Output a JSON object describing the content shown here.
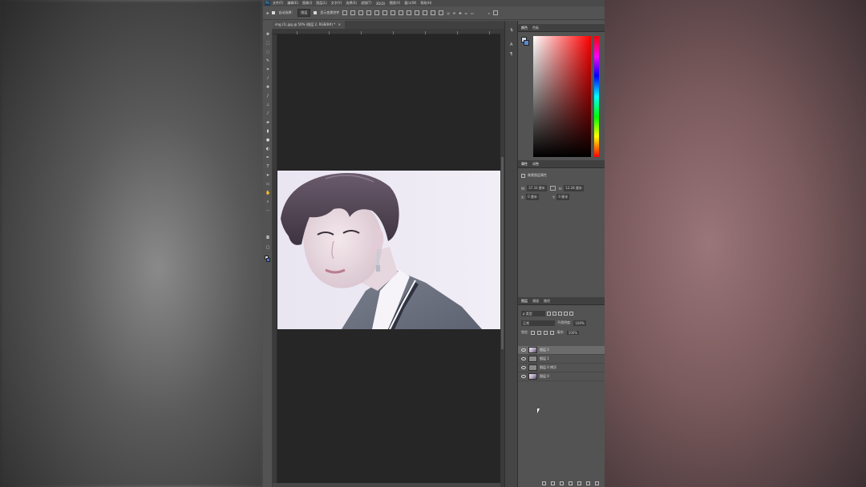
{
  "app": {
    "logo": "Ps",
    "menu": [
      "文件(F)",
      "编辑(E)",
      "图像(I)",
      "图层(L)",
      "文字(Y)",
      "选择(S)",
      "滤镜(T)",
      "3D(D)",
      "视图(V)",
      "窗口(W)",
      "帮助(H)"
    ]
  },
  "options_bar": {
    "auto_select_label": "自动选择：",
    "auto_select_value": "图层",
    "transform_label": "显示变换控件"
  },
  "document": {
    "tab_title": "img (1).jpg @ 50% (图层 2, RGB/8#) *",
    "close_glyph": "×"
  },
  "color_panel": {
    "tabs": [
      "颜色",
      "色板"
    ],
    "fg_color": "#ccd6e8",
    "bg_color": "#5a8ad0"
  },
  "properties_panel": {
    "tabs": [
      "属性",
      "调整"
    ],
    "title": "像素图层属性",
    "w_label": "W:",
    "w_value": "37.33 厘米",
    "h_label": "H:",
    "h_value": "12.28 厘米",
    "x_label": "X:",
    "x_value": "0 厘米",
    "y_label": "Y:",
    "y_value": "0 厘米",
    "link_glyph": "GO"
  },
  "layers_panel": {
    "tabs": [
      "图层",
      "通道",
      "路径"
    ],
    "filter_label": "ρ 类型",
    "blend_mode": "正常",
    "opacity_label": "不透明度:",
    "opacity_value": "100%",
    "lock_label": "锁定:",
    "fill_label": "填充:",
    "fill_value": "100%",
    "layers": [
      {
        "name": "图层 2",
        "selected": true,
        "thumb": "photo"
      },
      {
        "name": "图层 1",
        "selected": false,
        "thumb": "gray"
      },
      {
        "name": "图层 0 拷贝",
        "selected": false,
        "thumb": "gray"
      },
      {
        "name": "图层 0",
        "selected": false,
        "thumb": "photo"
      }
    ]
  }
}
